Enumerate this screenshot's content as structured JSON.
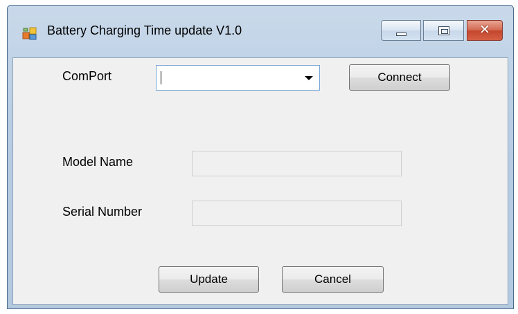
{
  "window": {
    "title": "Battery Charging Time update V1.0",
    "caption_buttons": {
      "minimize_icon": "minimize-icon",
      "maximize_icon": "maximize-icon",
      "close_glyph": "✕"
    },
    "accent_color": "#c5462d"
  },
  "form": {
    "comport": {
      "label": "ComPort",
      "value": "",
      "dropdown_icon": "chevron-down-icon"
    },
    "connect_label": "Connect",
    "model_name": {
      "label": "Model Name",
      "value": ""
    },
    "serial_number": {
      "label": "Serial Number",
      "value": ""
    },
    "update_label": "Update",
    "cancel_label": "Cancel"
  }
}
